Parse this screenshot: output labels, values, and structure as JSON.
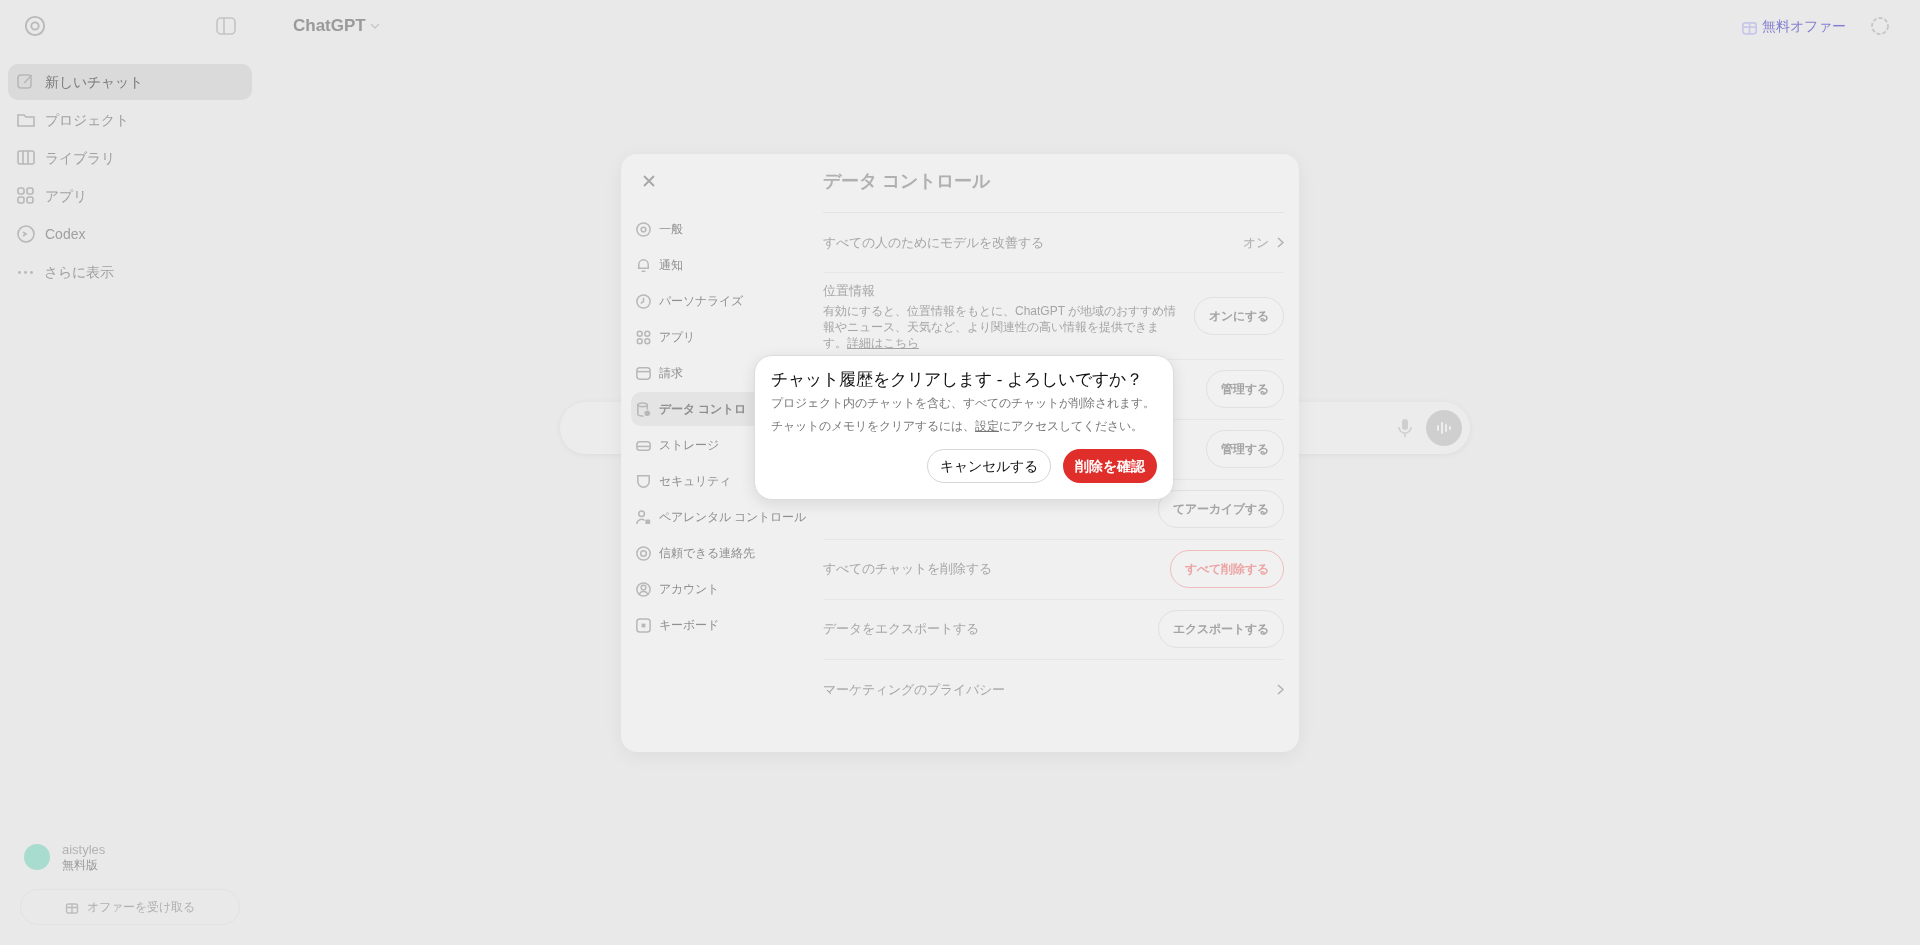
{
  "sidebar": {
    "items": [
      {
        "label": "新しいチャット",
        "selected": true
      },
      {
        "label": "プロジェクト",
        "selected": false
      },
      {
        "label": "ライブラリ",
        "selected": false
      },
      {
        "label": "アプリ",
        "selected": false
      },
      {
        "label": "Codex",
        "selected": false
      },
      {
        "label": "さらに表示",
        "selected": false
      }
    ],
    "user": {
      "name": "aistyles",
      "plan": "無料版"
    },
    "offer_button": "オファーを受け取る"
  },
  "header": {
    "model": "ChatGPT",
    "offer": "無料オファー"
  },
  "settings": {
    "nav": [
      {
        "label": "一般",
        "selected": false
      },
      {
        "label": "通知",
        "selected": false
      },
      {
        "label": "パーソナライズ",
        "selected": false
      },
      {
        "label": "アプリ",
        "selected": false
      },
      {
        "label": "請求",
        "selected": false
      },
      {
        "label": "データ コントロ",
        "selected": true
      },
      {
        "label": "ストレージ",
        "selected": false
      },
      {
        "label": "セキュリティ",
        "selected": false
      },
      {
        "label": "ペアレンタル コントロール",
        "selected": false
      },
      {
        "label": "信頼できる連絡先",
        "selected": false
      },
      {
        "label": "アカウント",
        "selected": false
      },
      {
        "label": "キーボード",
        "selected": false
      }
    ],
    "title": "データ コントロール",
    "rows": [
      {
        "kind": "link",
        "label": "すべての人のためにモデルを改善する",
        "value": "オン"
      },
      {
        "kind": "button",
        "label": "位置情報",
        "description": "有効にすると、位置情報をもとに、ChatGPT が地域のおすすめ情報やニュース、天気など、より関連性の高い情報を提供できます。",
        "link": "詳細はこちら",
        "button": "オンにする"
      },
      {
        "kind": "button",
        "button": "管理する"
      },
      {
        "kind": "button",
        "button": "管理する"
      },
      {
        "kind": "button",
        "button": "てアーカイブする"
      },
      {
        "kind": "danger",
        "label": "すべてのチャットを削除する",
        "button": "すべて削除する"
      },
      {
        "kind": "button",
        "label": "データをエクスポートする",
        "button": "エクスポートする"
      },
      {
        "kind": "link",
        "label": "マーケティングのプライバシー"
      }
    ]
  },
  "dialog": {
    "title": "チャット履歴をクリアします - よろしいですか？",
    "message": "プロジェクト内のチャットを含む、すべてのチャットが削除されます。",
    "note_before": "チャットのメモリをクリアするには、",
    "note_link": "設定",
    "note_after": "にアクセスしてください。",
    "cancel": "キャンセルする",
    "confirm": "削除を確認"
  }
}
